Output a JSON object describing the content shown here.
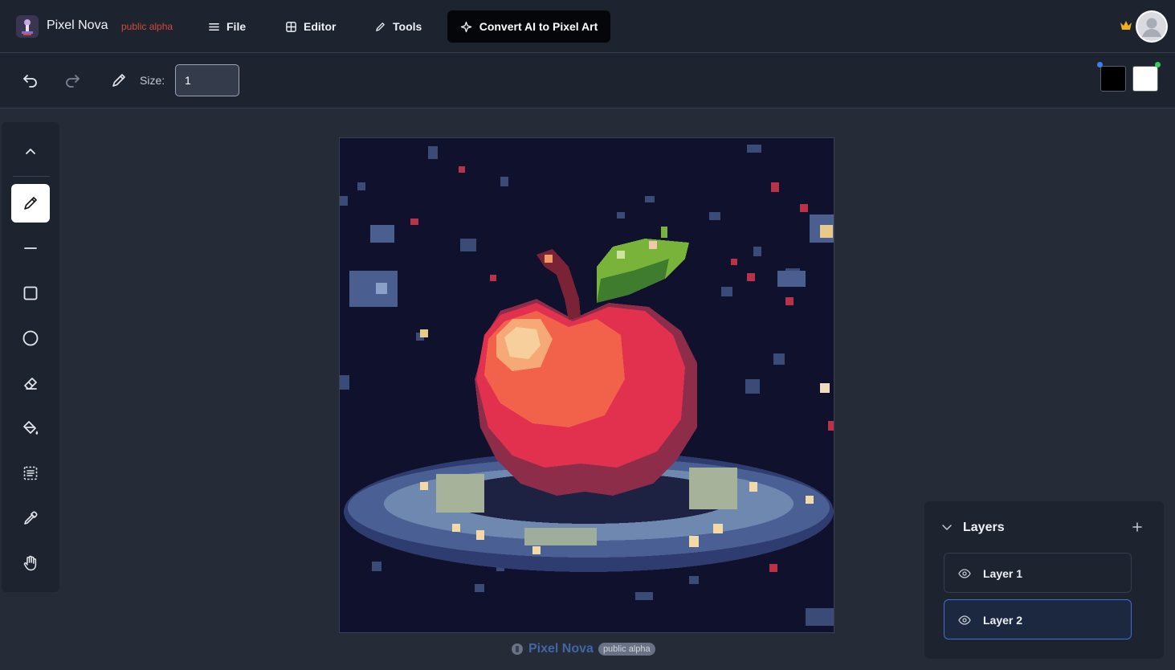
{
  "app": {
    "name": "Pixel Nova",
    "badge": "public alpha"
  },
  "nav": {
    "file": "File",
    "editor": "Editor",
    "tools": "Tools",
    "convert": "Convert AI to Pixel Art"
  },
  "toolbar": {
    "size_label": "Size:",
    "size_value": "1",
    "primary_color": "#000000",
    "secondary_color": "#ffffff"
  },
  "tools": [
    {
      "name": "collapse-toolbar",
      "icon": "chevron-up-icon"
    },
    {
      "name": "pencil",
      "icon": "pencil-icon",
      "active": true
    },
    {
      "name": "line",
      "icon": "line-icon"
    },
    {
      "name": "rectangle",
      "icon": "square-icon"
    },
    {
      "name": "circle",
      "icon": "circle-icon"
    },
    {
      "name": "eraser",
      "icon": "eraser-icon"
    },
    {
      "name": "fill",
      "icon": "paint-bucket-icon"
    },
    {
      "name": "select",
      "icon": "selection-icon"
    },
    {
      "name": "eyedropper",
      "icon": "eyedropper-icon"
    },
    {
      "name": "pan",
      "icon": "hand-icon"
    }
  ],
  "layers": {
    "title": "Layers",
    "items": [
      {
        "label": "Layer 1",
        "active": false
      },
      {
        "label": "Layer 2",
        "active": true
      }
    ]
  },
  "footer": {
    "name": "Pixel Nova",
    "badge": "public alpha"
  },
  "colors": {
    "accent_red": "#d4483a",
    "accent_blue": "#3d6fd6",
    "canvas_bg": "#10112d"
  }
}
